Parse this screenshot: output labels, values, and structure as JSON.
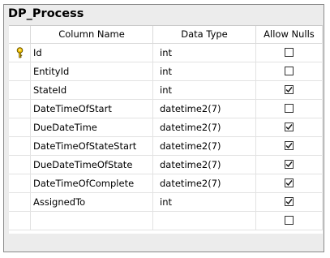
{
  "table": {
    "title": "DP_Process",
    "headers": {
      "column_name": "Column Name",
      "data_type": "Data Type",
      "allow_nulls": "Allow Nulls"
    },
    "rows": [
      {
        "name": "Id",
        "type": "int",
        "allow_nulls": false,
        "primary_key": true
      },
      {
        "name": "EntityId",
        "type": "int",
        "allow_nulls": false,
        "primary_key": false
      },
      {
        "name": "StateId",
        "type": "int",
        "allow_nulls": true,
        "primary_key": false
      },
      {
        "name": "DateTimeOfStart",
        "type": "datetime2(7)",
        "allow_nulls": false,
        "primary_key": false
      },
      {
        "name": "DueDateTime",
        "type": "datetime2(7)",
        "allow_nulls": true,
        "primary_key": false
      },
      {
        "name": "DateTimeOfStateStart",
        "type": "datetime2(7)",
        "allow_nulls": true,
        "primary_key": false
      },
      {
        "name": "DueDateTimeOfState",
        "type": "datetime2(7)",
        "allow_nulls": true,
        "primary_key": false
      },
      {
        "name": "DateTimeOfComplete",
        "type": "datetime2(7)",
        "allow_nulls": true,
        "primary_key": false
      },
      {
        "name": "AssignedTo",
        "type": "int",
        "allow_nulls": true,
        "primary_key": false
      },
      {
        "name": "",
        "type": "",
        "allow_nulls": false,
        "primary_key": false
      }
    ]
  },
  "icons": {
    "primary_key": "key-icon",
    "checked": "checkbox-checked-icon",
    "unchecked": "checkbox-unchecked-icon"
  },
  "colors": {
    "key_fill": "#f2c200",
    "window_bg": "#ececec",
    "grid_bg": "#ffffff"
  }
}
